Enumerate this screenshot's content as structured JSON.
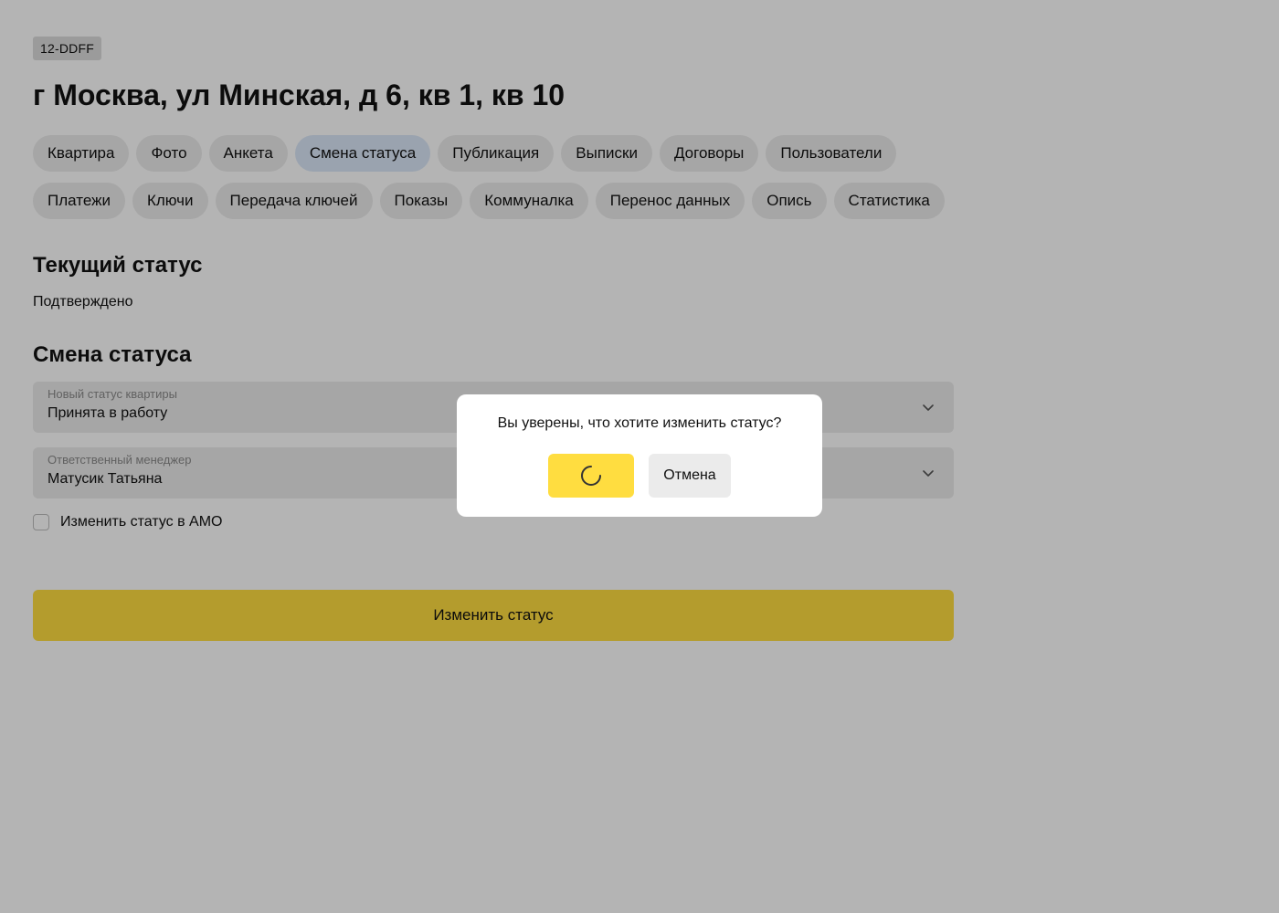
{
  "object": {
    "id": "12-DDFF",
    "address": "г Москва, ул Минская, д 6, кв 1, кв 10"
  },
  "tabs": [
    {
      "label": "Квартира",
      "active": false
    },
    {
      "label": "Фото",
      "active": false
    },
    {
      "label": "Анкета",
      "active": false
    },
    {
      "label": "Смена статуса",
      "active": true
    },
    {
      "label": "Публикация",
      "active": false
    },
    {
      "label": "Выписки",
      "active": false
    },
    {
      "label": "Договоры",
      "active": false
    },
    {
      "label": "Пользователи",
      "active": false
    },
    {
      "label": "Платежи",
      "active": false
    },
    {
      "label": "Ключи",
      "active": false
    },
    {
      "label": "Передача ключей",
      "active": false
    },
    {
      "label": "Показы",
      "active": false
    },
    {
      "label": "Коммуналка",
      "active": false
    },
    {
      "label": "Перенос данных",
      "active": false
    },
    {
      "label": "Опись",
      "active": false
    },
    {
      "label": "Статистика",
      "active": false
    }
  ],
  "current_status": {
    "title": "Текущий статус",
    "value": "Подтверждено"
  },
  "change_status": {
    "title": "Смена статуса",
    "new_status": {
      "label": "Новый статус квартиры",
      "value": "Принята в работу"
    },
    "manager": {
      "label": "Ответственный менеджер",
      "value": "Матусик Татьяна"
    },
    "amo_checkbox": {
      "label": "Изменить статус в АМО",
      "checked": false
    },
    "submit_label": "Изменить статус"
  },
  "modal": {
    "message": "Вы уверены, что хотите изменить статус?",
    "confirm_state": "loading",
    "cancel_label": "Отмена"
  },
  "colors": {
    "accent_yellow": "#ffdd40",
    "active_tab": "#dbe7f8",
    "chip_bg": "#ebebeb"
  }
}
